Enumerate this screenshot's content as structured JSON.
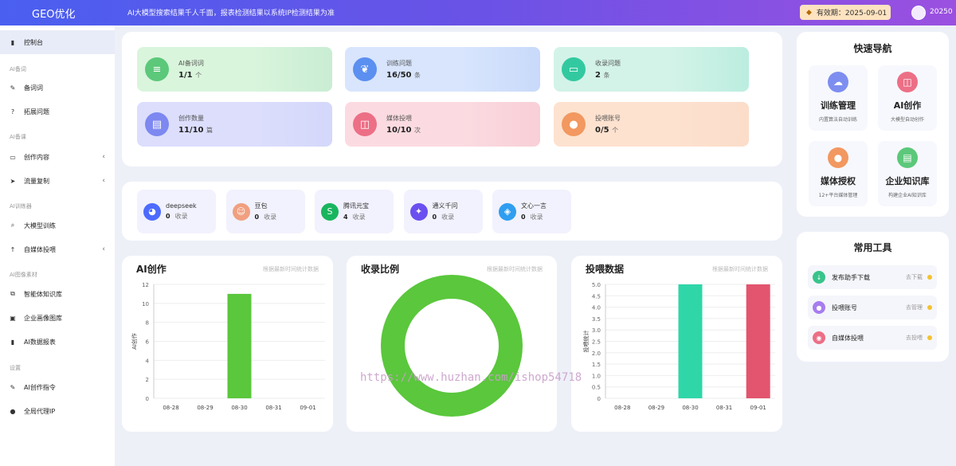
{
  "header": {
    "brand": "GEO优化",
    "slogan": "AI大模型搜索结果千人千面，报表检测结果以系统IP检测结果为准",
    "expire_label": "有效期：2025-09-01",
    "user": "20250"
  },
  "sidebar": {
    "dashboard": "控制台",
    "group_keywords": "AI备词",
    "keywords": "备词词",
    "expand_questions": "拓展问题",
    "group_material": "AI备课",
    "create_content": "创作内容",
    "traffic_copy": "流量复制",
    "group_training": "AI训练器",
    "llm_training": "大模型训练",
    "media_publish": "自媒体投喂",
    "group_image": "AI图像素材",
    "knowledge_base": "智能体知识库",
    "enterprise_gallery": "企业画像图库",
    "ai_report": "AI数据报表",
    "group_settings": "设置",
    "ai_prompt": "AI创作指令",
    "global_proxy": "全局代理IP"
  },
  "stats": [
    {
      "label": "AI备词词",
      "value": "1/1",
      "unit": "个",
      "color": "#5cc87a",
      "bg": "#d9f5dc",
      "icon": "list-icon"
    },
    {
      "label": "训练问题",
      "value": "16/50",
      "unit": "条",
      "color": "#5b8ff0",
      "bg": "#d8e5fd",
      "icon": "leaf-icon"
    },
    {
      "label": "收录问题",
      "value": "2",
      "unit": "条",
      "color": "#33c9a0",
      "bg": "#d3f3e8",
      "icon": "folder-icon"
    },
    {
      "label": "创作数量",
      "value": "11/10",
      "unit": "篇",
      "color": "#7d88f0",
      "bg": "#dcdefc",
      "icon": "document-icon"
    },
    {
      "label": "媒体投喂",
      "value": "10/10",
      "unit": "次",
      "color": "#ec6f86",
      "bg": "#fbdbe1",
      "icon": "basket-icon"
    },
    {
      "label": "投喂账号",
      "value": "0/5",
      "unit": "个",
      "color": "#f29860",
      "bg": "#fde2cf",
      "icon": "user-icon"
    }
  ],
  "engines": [
    {
      "name": "deepseek",
      "count": "0",
      "unit": "收录",
      "color": "#4d6bfe",
      "icon": "whale-icon"
    },
    {
      "name": "豆包",
      "count": "0",
      "unit": "收录",
      "color": "#f0a080",
      "icon": "girl-avatar-icon"
    },
    {
      "name": "腾讯元宝",
      "count": "4",
      "unit": "收录",
      "color": "#19b55e",
      "icon": "yuanbao-icon"
    },
    {
      "name": "通义千问",
      "count": "0",
      "unit": "收录",
      "color": "#6b4ff0",
      "icon": "tongyi-icon"
    },
    {
      "name": "文心一言",
      "count": "0",
      "unit": "收录",
      "color": "#2f9ef0",
      "icon": "cube-icon"
    }
  ],
  "charts": {
    "ai_create": {
      "title": "AI创作",
      "hint": "根据最新时间统计数据"
    },
    "index_ratio": {
      "title": "收录比例",
      "hint": "根据最新时间统计数据"
    },
    "feed_data": {
      "title": "投喂数据",
      "hint": "根据最新时间统计数据"
    }
  },
  "chart_data": [
    {
      "type": "bar",
      "title": "AI创作",
      "categories": [
        "08-28",
        "08-29",
        "08-30",
        "08-31",
        "09-01"
      ],
      "values": [
        0,
        0,
        11,
        0,
        0
      ],
      "ylabel": "AI创作",
      "ylim": [
        0,
        12
      ],
      "yticks": [
        "0",
        "2",
        "4",
        "6",
        "8",
        "10",
        "12"
      ],
      "colors": [
        "#5ac73c"
      ]
    },
    {
      "type": "pie",
      "title": "收录比例",
      "values": [
        1
      ],
      "colors": [
        "#5ac73c"
      ]
    },
    {
      "type": "bar",
      "title": "投喂数据",
      "categories": [
        "08-28",
        "08-29",
        "08-30",
        "08-31",
        "09-01"
      ],
      "values": [
        0,
        0,
        5,
        0,
        5
      ],
      "ylabel": "投喂统计",
      "ylim": [
        0,
        5
      ],
      "yticks": [
        "0",
        "0.5",
        "1.0",
        "1.5",
        "2.0",
        "2.5",
        "3.0",
        "3.5",
        "4.0",
        "4.5",
        "5.0"
      ],
      "colors": [
        "#2fd6a8",
        "#e3546e"
      ]
    }
  ],
  "quick_nav": {
    "title": "快速导航",
    "items": [
      {
        "label": "训练管理",
        "desc": "内置算法自动训练",
        "color": "#7d8ef0",
        "icon": "cloud-icon"
      },
      {
        "label": "AI创作",
        "desc": "大模型自动创作",
        "color": "#ec6f86",
        "icon": "basket-icon"
      },
      {
        "label": "媒体授权",
        "desc": "12+平台媒体管理",
        "color": "#f29860",
        "icon": "user-icon"
      },
      {
        "label": "企业知识库",
        "desc": "构建企业AI知识库",
        "color": "#5cc87a",
        "icon": "book-icon"
      }
    ]
  },
  "tools": {
    "title": "常用工具",
    "items": [
      {
        "label": "发布助手下载",
        "action": "去下载",
        "color": "#39c48b",
        "icon": "download-icon"
      },
      {
        "label": "投喂账号",
        "action": "去管理",
        "color": "#a77df0",
        "icon": "user-icon"
      },
      {
        "label": "自媒体投喂",
        "action": "去投喂",
        "color": "#ec6f86",
        "icon": "feed-icon"
      }
    ]
  },
  "watermark": "https://www.huzhan.com/ishop54718"
}
